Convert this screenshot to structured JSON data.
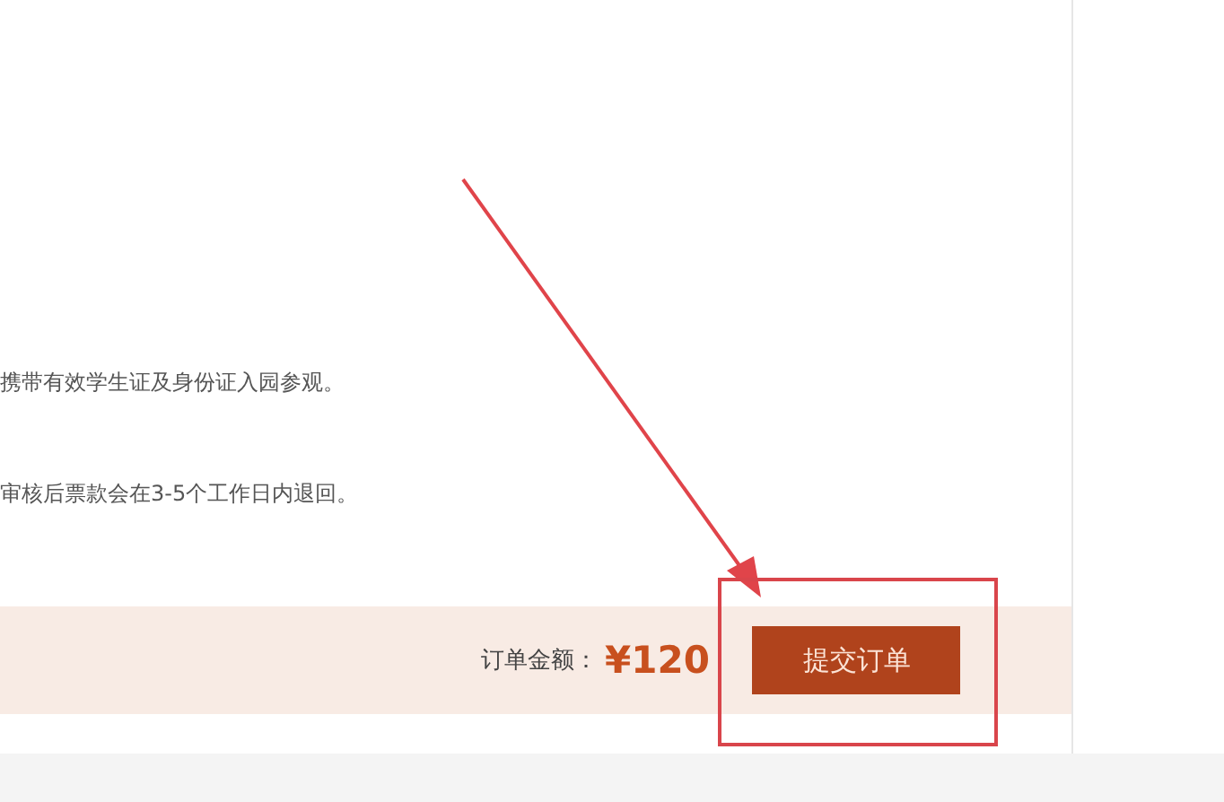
{
  "notes": [
    "携带有效学生证及身份证入园参观。",
    "审核后票款会在3-5个工作日内退回。"
  ],
  "order_bar": {
    "amount_label": "订单金额：",
    "amount": "¥120",
    "submit_button": "提交订单"
  }
}
